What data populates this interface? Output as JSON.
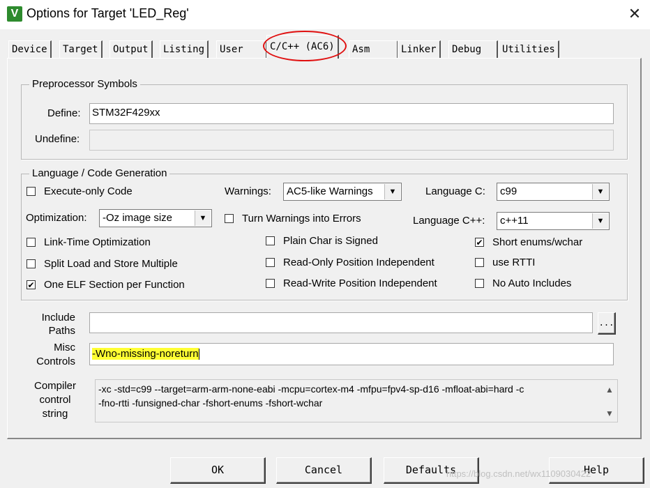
{
  "window": {
    "title": "Options for Target 'LED_Reg'",
    "app_icon_glyph": "V",
    "close_glyph": "✕"
  },
  "tabs": [
    "Device",
    "Target",
    "Output",
    "Listing",
    "User",
    "C/C++ (AC6)",
    "Asm",
    "Linker",
    "Debug",
    "Utilities"
  ],
  "active_tab": "C/C++ (AC6)",
  "preprocessor": {
    "title": "Preprocessor Symbols",
    "define_label": "Define:",
    "define_value": "STM32F429xx",
    "undefine_label": "Undefine:",
    "undefine_value": ""
  },
  "language": {
    "title": "Language / Code Generation",
    "execute_only": {
      "label": "Execute-only Code",
      "checked": false
    },
    "optimization_label": "Optimization:",
    "optimization_value": "-Oz image size",
    "lto": {
      "label": "Link-Time Optimization",
      "checked": false
    },
    "split_ldm": {
      "label": "Split Load and Store Multiple",
      "checked": false
    },
    "one_elf": {
      "label": "One ELF Section per Function",
      "checked": true
    },
    "warnings_label": "Warnings:",
    "warnings_value": "AC5-like Warnings",
    "warnings_errors": {
      "label": "Turn Warnings into Errors",
      "checked": false
    },
    "plain_char": {
      "label": "Plain Char is Signed",
      "checked": false
    },
    "ro_pi": {
      "label": "Read-Only Position Independent",
      "checked": false
    },
    "rw_pi": {
      "label": "Read-Write Position Independent",
      "checked": false
    },
    "lang_c_label": "Language C:",
    "lang_c_value": "c99",
    "lang_cpp_label": "Language C++:",
    "lang_cpp_value": "c++11",
    "short_enums": {
      "label": "Short enums/wchar",
      "checked": true
    },
    "rtti": {
      "label": "use RTTI",
      "checked": false
    },
    "no_auto_includes": {
      "label": "No Auto Includes",
      "checked": false
    }
  },
  "include": {
    "label_line1": "Include",
    "label_line2": "Paths",
    "value": "",
    "browse_label": "..."
  },
  "misc": {
    "label_line1": "Misc",
    "label_line2": "Controls",
    "value": "-Wno-missing-noreturn"
  },
  "compiler": {
    "label_line1": "Compiler",
    "label_line2": "control",
    "label_line3": "string",
    "line1": "-xc -std=c99 --target=arm-arm-none-eabi -mcpu=cortex-m4 -mfpu=fpv4-sp-d16 -mfloat-abi=hard -c",
    "line2": "-fno-rtti -funsigned-char -fshort-enums -fshort-wchar"
  },
  "buttons": {
    "ok": "OK",
    "cancel": "Cancel",
    "defaults": "Defaults",
    "help": "Help"
  },
  "watermark": "https://blog.csdn.net/wx1109030422",
  "colors": {
    "highlight": "#ffff33",
    "annotation_circle": "#e01010"
  }
}
